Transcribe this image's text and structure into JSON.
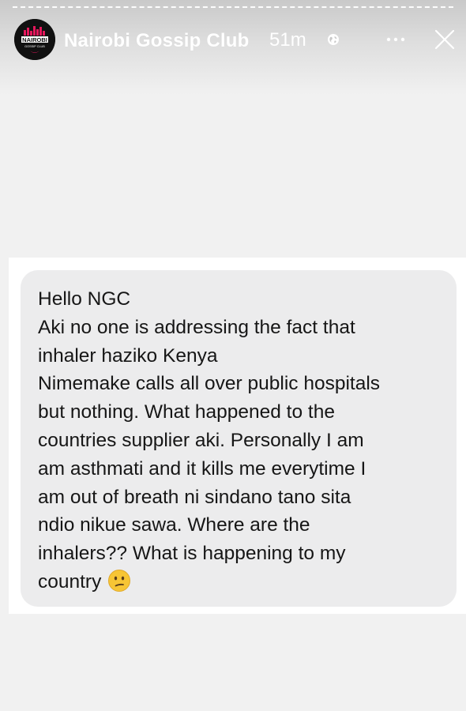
{
  "story": {
    "account_name": "Nairobi Gossip Club",
    "time_ago": "51m",
    "avatar": {
      "line1": "NAIROBI",
      "line2": "GOSSIP CLUB",
      "bg_color": "#111111",
      "accent_color": "#e6175c"
    },
    "icons": {
      "globe": "globe-icon",
      "more": "more-options-icon",
      "close": "close-icon"
    }
  },
  "message": {
    "lines": [
      "Hello NGC",
      "Aki no one is addressing the fact that",
      "inhaler haziko Kenya",
      "Nimemake calls all over public hospitals",
      "but nothing. What happened to the",
      "countries supplier aki. Personally I am",
      "am asthmati and it kills me everytime I",
      "am out of breath ni sindano tano sita",
      "ndio nikue sawa. Where are the",
      "inhalers?? What is happening to my",
      "country"
    ],
    "emoji": "confused-face",
    "bubble_color": "#ececed",
    "text_color": "#161616"
  }
}
